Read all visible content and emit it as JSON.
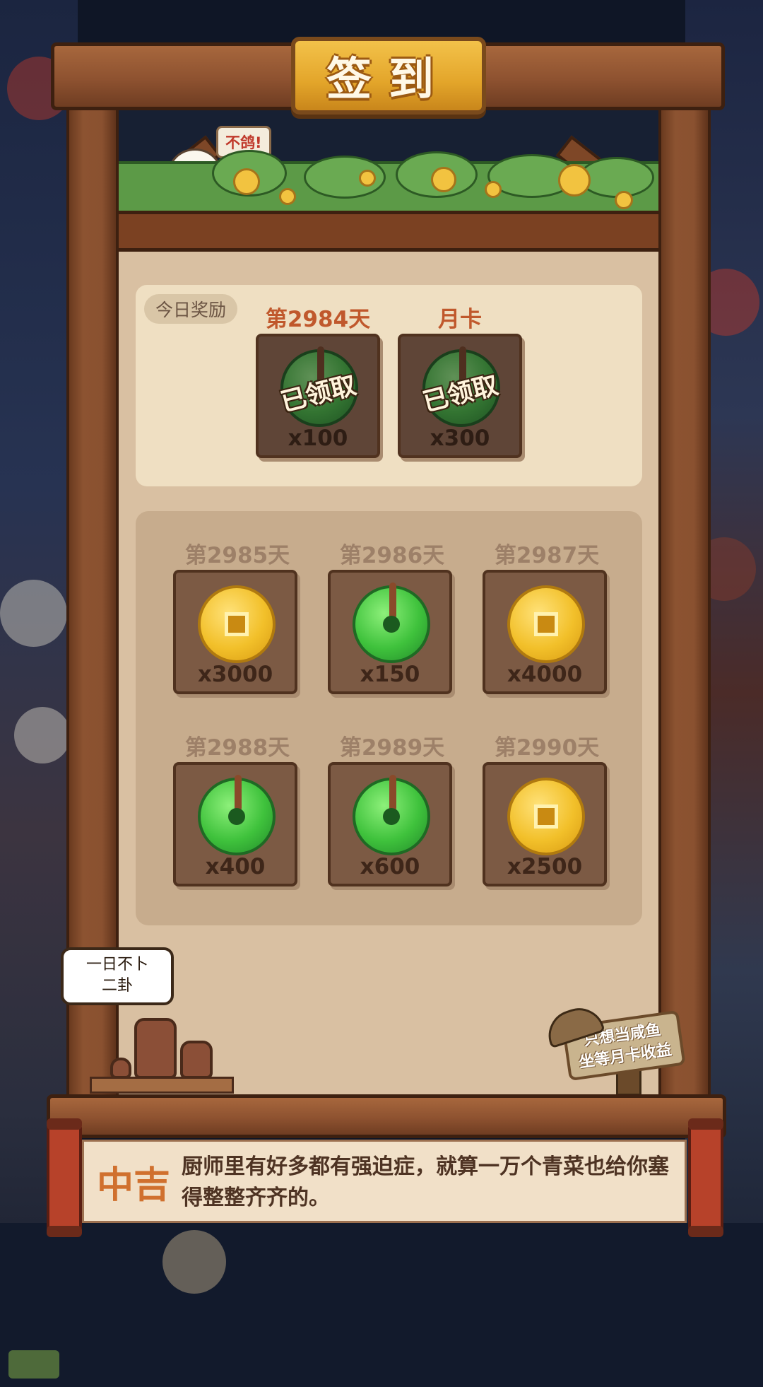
{
  "title": "签到",
  "scene": {
    "chick_bubble": "不鸽!"
  },
  "today": {
    "badge": "今日奖励",
    "rewards": [
      {
        "label": "第2984天",
        "status": "已领取",
        "amount": "x100"
      },
      {
        "label": "月卡",
        "status": "已领取",
        "amount": "x300"
      }
    ]
  },
  "week": [
    {
      "label": "第2985天",
      "item": "coin",
      "amount": "x3000"
    },
    {
      "label": "第2986天",
      "item": "jade",
      "amount": "x150"
    },
    {
      "label": "第2987天",
      "item": "coin",
      "amount": "x4000"
    },
    {
      "label": "第2988天",
      "item": "jade",
      "amount": "x400"
    },
    {
      "label": "第2989天",
      "item": "jade",
      "amount": "x600"
    },
    {
      "label": "第2990天",
      "item": "coin",
      "amount": "x2500"
    }
  ],
  "divination": {
    "line1": "一日不卜",
    "line2": "二卦"
  },
  "sign": {
    "line1": "只想当咸鱼",
    "line2": "坐等月卡收益"
  },
  "fortune": {
    "level": "中吉",
    "text": "厨师里有好多都有强迫症，就算一万个青菜也给你塞得整整齐齐的。"
  },
  "colors": {
    "accent": "#e3a52a",
    "wood": "#8c5331",
    "jade": "#3fc23c",
    "coin": "#f2c02a",
    "fortune": "#d0702e"
  }
}
